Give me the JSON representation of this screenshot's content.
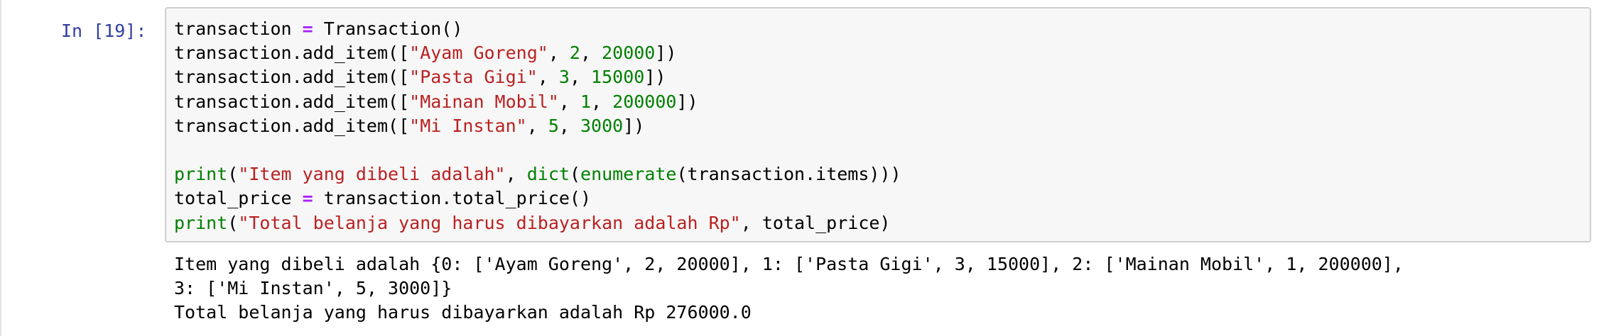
{
  "cell": {
    "prompt": "In [19]:",
    "code_lines": [
      [
        {
          "t": "transaction "
        },
        {
          "t": "=",
          "k": "op"
        },
        {
          "t": " Transaction()"
        }
      ],
      [
        {
          "t": "transaction.add_item(["
        },
        {
          "t": "\"Ayam Goreng\"",
          "k": "str"
        },
        {
          "t": ", "
        },
        {
          "t": "2",
          "k": "num"
        },
        {
          "t": ", "
        },
        {
          "t": "20000",
          "k": "num"
        },
        {
          "t": "])"
        }
      ],
      [
        {
          "t": "transaction.add_item(["
        },
        {
          "t": "\"Pasta Gigi\"",
          "k": "str"
        },
        {
          "t": ", "
        },
        {
          "t": "3",
          "k": "num"
        },
        {
          "t": ", "
        },
        {
          "t": "15000",
          "k": "num"
        },
        {
          "t": "])"
        }
      ],
      [
        {
          "t": "transaction.add_item(["
        },
        {
          "t": "\"Mainan Mobil\"",
          "k": "str"
        },
        {
          "t": ", "
        },
        {
          "t": "1",
          "k": "num"
        },
        {
          "t": ", "
        },
        {
          "t": "200000",
          "k": "num"
        },
        {
          "t": "])"
        }
      ],
      [
        {
          "t": "transaction.add_item(["
        },
        {
          "t": "\"Mi Instan\"",
          "k": "str"
        },
        {
          "t": ", "
        },
        {
          "t": "5",
          "k": "num"
        },
        {
          "t": ", "
        },
        {
          "t": "3000",
          "k": "num"
        },
        {
          "t": "])"
        }
      ],
      [
        {
          "t": ""
        }
      ],
      [
        {
          "t": "print",
          "k": "builtin"
        },
        {
          "t": "("
        },
        {
          "t": "\"Item yang dibeli adalah\"",
          "k": "str"
        },
        {
          "t": ", "
        },
        {
          "t": "dict",
          "k": "builtin"
        },
        {
          "t": "("
        },
        {
          "t": "enumerate",
          "k": "builtin"
        },
        {
          "t": "(transaction.items)))"
        }
      ],
      [
        {
          "t": "total_price "
        },
        {
          "t": "=",
          "k": "op"
        },
        {
          "t": " transaction.total_price()"
        }
      ],
      [
        {
          "t": "print",
          "k": "builtin"
        },
        {
          "t": "("
        },
        {
          "t": "\"Total belanja yang harus dibayarkan adalah Rp\"",
          "k": "str"
        },
        {
          "t": ", total_price)"
        }
      ]
    ],
    "output_lines": [
      "Item yang dibeli adalah {0: ['Ayam Goreng', 2, 20000], 1: ['Pasta Gigi', 3, 15000], 2: ['Mainan Mobil', 1, 200000],",
      "3: ['Mi Instan', 5, 3000]}",
      "Total belanja yang harus dibayarkan adalah Rp 276000.0"
    ]
  },
  "colors": {
    "prompt": "#303f9f",
    "string": "#ba2121",
    "number": "#008000",
    "operator": "#aa22ff",
    "builtin": "#008000",
    "input_background": "#f7f7f7",
    "input_border": "#cfcfcf"
  }
}
